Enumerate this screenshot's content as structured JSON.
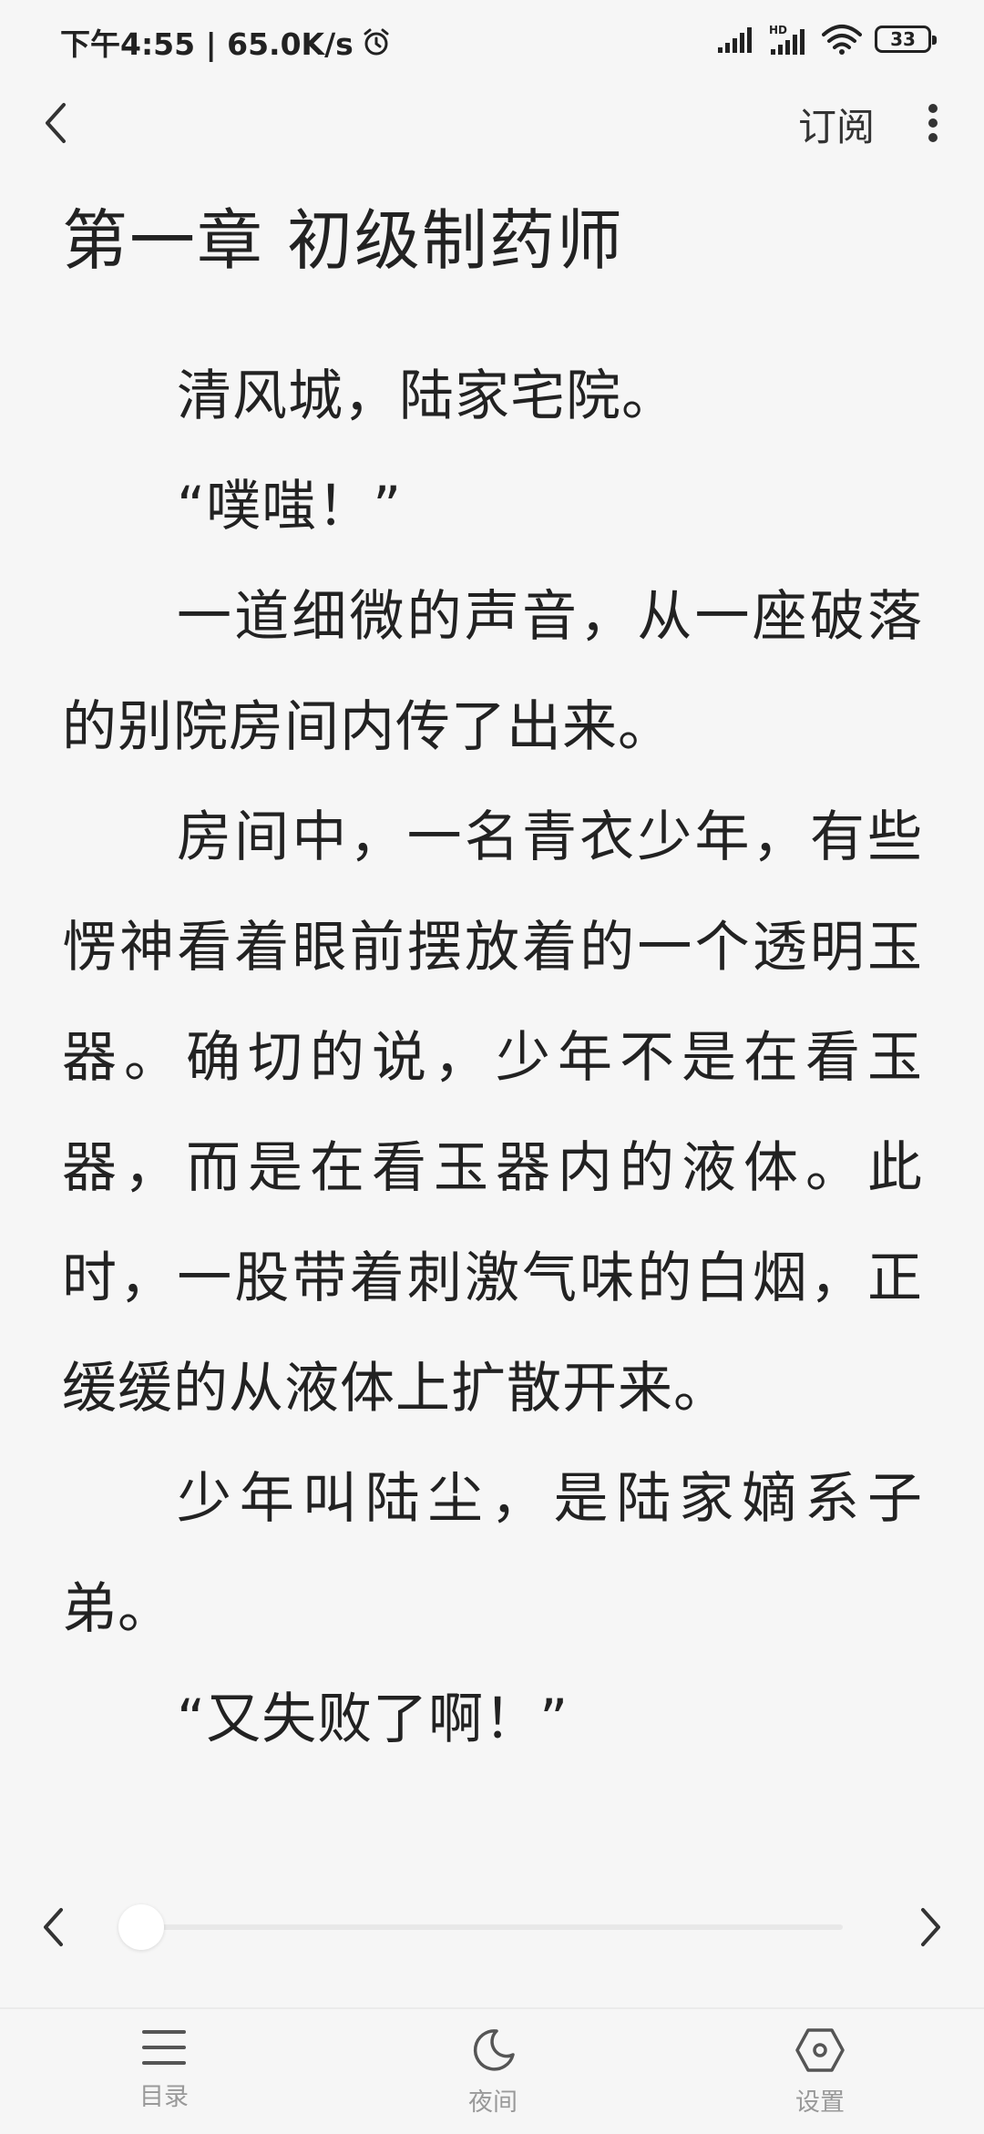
{
  "status_bar": {
    "time_speed": "下午4:55 | 65.0K/s",
    "battery": "33"
  },
  "header": {
    "subscribe_label": "订阅"
  },
  "chapter": {
    "title": "第一章 初级制药师",
    "paragraphs": [
      "清风城，陆家宅院。",
      "“噗嗤！”",
      "一道细微的声音，从一座破落的别院房间内传了出来。",
      "房间中，一名青衣少年，有些愣神看着眼前摆放着的一个透明玉器。确切的说，少年不是在看玉器，而是在看玉器内的液体。此时，一股带着刺激气味的白烟，正缓缓的从液体上扩散开来。",
      "少年叫陆尘，是陆家嫡系子弟。",
      "“又失败了啊！”"
    ]
  },
  "progress": {
    "value": 0
  },
  "bottom_nav": {
    "toc_label": "目录",
    "night_label": "夜间",
    "settings_label": "设置"
  }
}
